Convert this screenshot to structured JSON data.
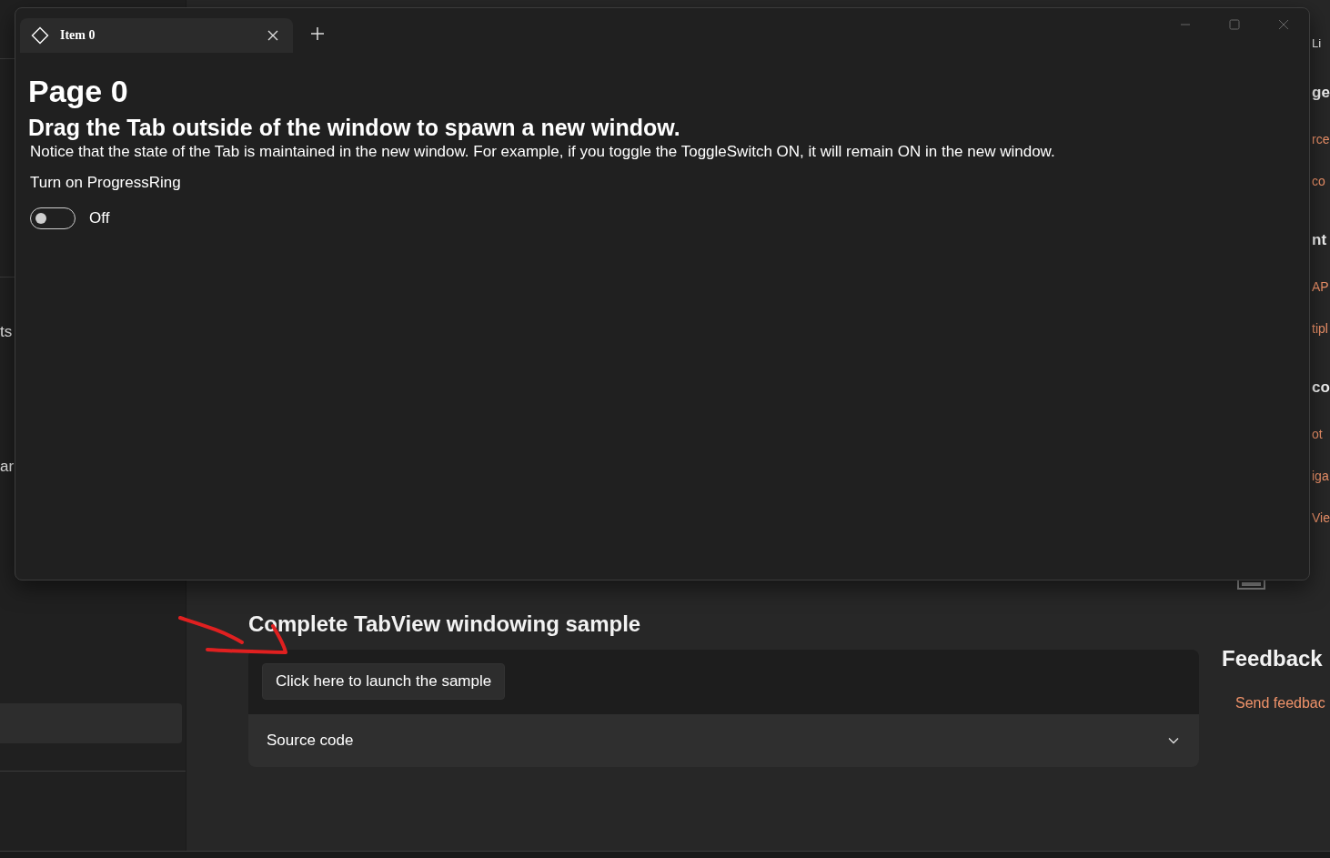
{
  "window": {
    "tabs": [
      {
        "label": "Item 0",
        "selected": true
      }
    ],
    "page": {
      "title": "Page 0",
      "subtitle": "Drag the Tab outside of the window to spawn a new window.",
      "description": "Notice that the state of the Tab is maintained in the new window. For example, if you toggle the ToggleSwitch ON, it will remain ON in the new window.",
      "toggle": {
        "header": "Turn on ProgressRing",
        "on": false,
        "state_label": "Off"
      }
    }
  },
  "nav": {
    "fragments": [
      "ts",
      "ar"
    ]
  },
  "main": {
    "section_title": "Complete TabView windowing sample",
    "launch_button": "Click here to launch the sample",
    "expander": {
      "label": "Source code",
      "expanded": false
    }
  },
  "side": {
    "fragments": [
      {
        "kind": "text",
        "text": "Li"
      },
      {
        "kind": "heading",
        "text": "ge"
      },
      {
        "kind": "link",
        "text": "rce"
      },
      {
        "kind": "link",
        "text": "co"
      },
      {
        "kind": "heading",
        "text": "nt"
      },
      {
        "kind": "link",
        "text": "AP"
      },
      {
        "kind": "link",
        "text": "tipl"
      },
      {
        "kind": "heading",
        "text": "co"
      },
      {
        "kind": "link",
        "text": "ot"
      },
      {
        "kind": "link",
        "text": "iga"
      },
      {
        "kind": "link",
        "text": "Vie"
      }
    ],
    "feedback_title": "Feedback",
    "feedback_link": "Send feedbac"
  }
}
